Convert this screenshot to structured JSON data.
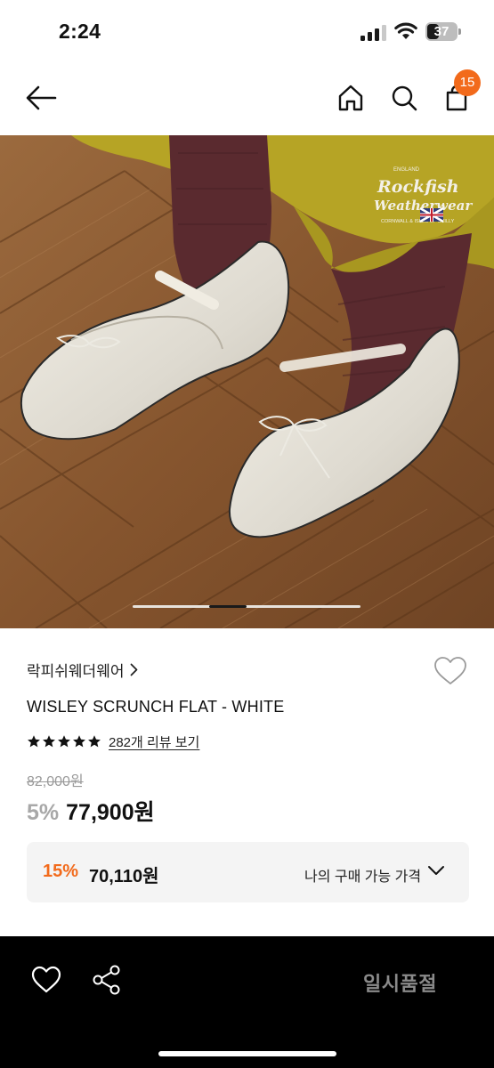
{
  "status_bar": {
    "time": "2:24",
    "battery": "37"
  },
  "nav": {
    "back_icon": "arrow-left-icon",
    "home_icon": "home-icon",
    "search_icon": "search-icon",
    "cart_icon": "shopping-bag-icon",
    "cart_count": "15"
  },
  "hero": {
    "logo_text_line1": "Rockfish",
    "logo_text_line2": "Weatherwear",
    "logo_small_top": "ENGLAND",
    "logo_small_bottom": "CORNWALL & ISLES OF SCILLY",
    "carousel_position": 0.38
  },
  "product": {
    "brand": "락피쉬웨더웨어",
    "title": "WISLEY SCRUNCH FLAT - WHITE",
    "star_count": 5,
    "review_text": "282개 리뷰 보기",
    "original_price": "82,000원",
    "discount_rate": "5%",
    "sale_price": "77,900원"
  },
  "my_price": {
    "rate": "15%",
    "price": "70,110원",
    "label": "나의 구매 가능 가격"
  },
  "bottom_bar": {
    "sold_out_label": "일시품절"
  },
  "colors": {
    "accent": "#f26a1b",
    "bottom_bar": "#000000",
    "sold_out_text": "#8a8a8a"
  }
}
